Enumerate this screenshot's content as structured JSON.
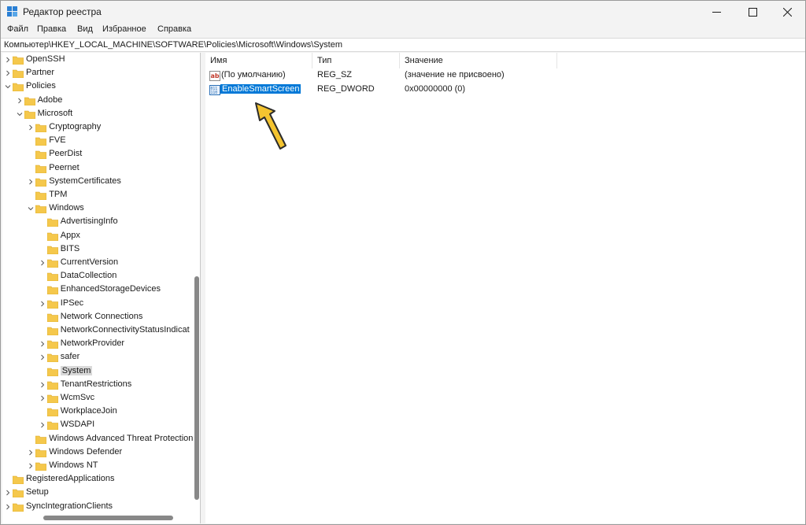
{
  "window": {
    "title": "Редактор реестра",
    "icon": "regedit-icon"
  },
  "titlebar_buttons": {
    "minimize": "minimize-icon",
    "maximize": "maximize-icon",
    "close": "close-icon"
  },
  "menu": {
    "items": [
      "Файл",
      "Правка",
      "Вид",
      "Избранное",
      "Справка"
    ]
  },
  "address": {
    "path": "Компьютер\\HKEY_LOCAL_MACHINE\\SOFTWARE\\Policies\\Microsoft\\Windows\\System"
  },
  "tree": {
    "items": [
      {
        "label": "OpenSSH",
        "level": 0,
        "expander": "collapsed",
        "selected": false
      },
      {
        "label": "Partner",
        "level": 0,
        "expander": "collapsed",
        "selected": false
      },
      {
        "label": "Policies",
        "level": 0,
        "expander": "expanded",
        "selected": false
      },
      {
        "label": "Adobe",
        "level": 1,
        "expander": "collapsed",
        "selected": false
      },
      {
        "label": "Microsoft",
        "level": 1,
        "expander": "expanded",
        "selected": false
      },
      {
        "label": "Cryptography",
        "level": 2,
        "expander": "collapsed",
        "selected": false
      },
      {
        "label": "FVE",
        "level": 2,
        "expander": "none",
        "selected": false
      },
      {
        "label": "PeerDist",
        "level": 2,
        "expander": "none",
        "selected": false
      },
      {
        "label": "Peernet",
        "level": 2,
        "expander": "none",
        "selected": false
      },
      {
        "label": "SystemCertificates",
        "level": 2,
        "expander": "collapsed",
        "selected": false
      },
      {
        "label": "TPM",
        "level": 2,
        "expander": "none",
        "selected": false
      },
      {
        "label": "Windows",
        "level": 2,
        "expander": "expanded",
        "selected": false
      },
      {
        "label": "AdvertisingInfo",
        "level": 3,
        "expander": "none",
        "selected": false
      },
      {
        "label": "Appx",
        "level": 3,
        "expander": "none",
        "selected": false
      },
      {
        "label": "BITS",
        "level": 3,
        "expander": "none",
        "selected": false
      },
      {
        "label": "CurrentVersion",
        "level": 3,
        "expander": "collapsed",
        "selected": false
      },
      {
        "label": "DataCollection",
        "level": 3,
        "expander": "none",
        "selected": false
      },
      {
        "label": "EnhancedStorageDevices",
        "level": 3,
        "expander": "none",
        "selected": false
      },
      {
        "label": "IPSec",
        "level": 3,
        "expander": "collapsed",
        "selected": false
      },
      {
        "label": "Network Connections",
        "level": 3,
        "expander": "none",
        "selected": false
      },
      {
        "label": "NetworkConnectivityStatusIndicat",
        "level": 3,
        "expander": "none",
        "selected": false
      },
      {
        "label": "NetworkProvider",
        "level": 3,
        "expander": "collapsed",
        "selected": false
      },
      {
        "label": "safer",
        "level": 3,
        "expander": "collapsed",
        "selected": false
      },
      {
        "label": "System",
        "level": 3,
        "expander": "none",
        "selected": true
      },
      {
        "label": "TenantRestrictions",
        "level": 3,
        "expander": "collapsed",
        "selected": false
      },
      {
        "label": "WcmSvc",
        "level": 3,
        "expander": "collapsed",
        "selected": false
      },
      {
        "label": "WorkplaceJoin",
        "level": 3,
        "expander": "none",
        "selected": false
      },
      {
        "label": "WSDAPI",
        "level": 3,
        "expander": "collapsed",
        "selected": false
      },
      {
        "label": "Windows Advanced Threat Protection",
        "level": 2,
        "expander": "none",
        "selected": false
      },
      {
        "label": "Windows Defender",
        "level": 2,
        "expander": "collapsed",
        "selected": false
      },
      {
        "label": "Windows NT",
        "level": 2,
        "expander": "collapsed",
        "selected": false
      },
      {
        "label": "RegisteredApplications",
        "level": 0,
        "expander": "none",
        "selected": false
      },
      {
        "label": "Setup",
        "level": 0,
        "expander": "collapsed",
        "selected": false
      },
      {
        "label": "SyncIntegrationClients",
        "level": 0,
        "expander": "collapsed",
        "selected": false
      }
    ]
  },
  "values": {
    "columns": {
      "name": "Имя",
      "type": "Тип",
      "data": "Значение"
    },
    "rows": [
      {
        "name": "(По умолчанию)",
        "type": "REG_SZ",
        "data": "(значение не присвоено)",
        "icon": "string-value-icon",
        "highlighted": false
      },
      {
        "name": "EnableSmartScreen",
        "type": "REG_DWORD",
        "data": "0x00000000 (0)",
        "icon": "binary-value-icon",
        "highlighted": true
      }
    ]
  },
  "colors": {
    "selection": "#0078d7",
    "folder": "#f5c84c",
    "arrow": "#f4c430"
  }
}
